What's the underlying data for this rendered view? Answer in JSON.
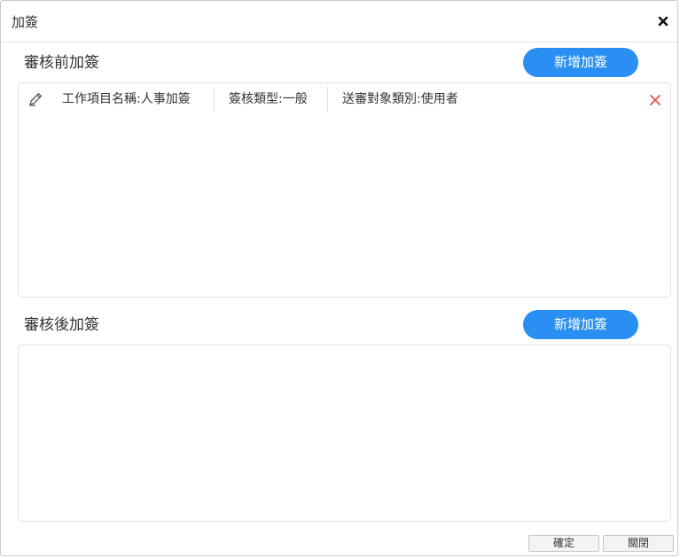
{
  "dialog": {
    "title": "加簽",
    "close_icon": "close-icon"
  },
  "before_section": {
    "title": "審核前加簽",
    "add_button": "新增加簽",
    "items": [
      {
        "work_item_name": "工作項目名稱:人事加簽",
        "sign_type": "簽核類型:一般",
        "target_type": "送審對象類別:使用者",
        "edit_icon": "pencil-icon",
        "delete_icon": "delete-icon"
      }
    ]
  },
  "after_section": {
    "title": "審核後加簽",
    "add_button": "新增加簽",
    "items": []
  },
  "footer": {
    "confirm_label": "確定",
    "close_label": "關閉"
  },
  "colors": {
    "accent": "#2a8ff2",
    "delete": "#e0524f"
  }
}
